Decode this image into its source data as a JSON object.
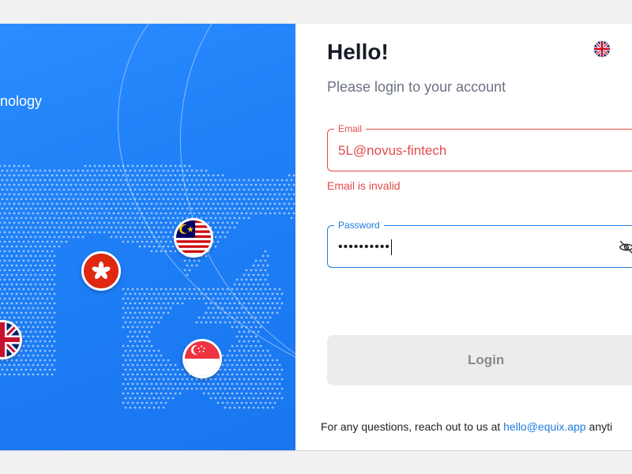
{
  "hero": {
    "tagline": "nology"
  },
  "flags": {
    "malaysia": "malaysia-flag-icon",
    "hong_kong": "hong-kong-flag-icon",
    "uk": "uk-flag-icon",
    "singapore": "singapore-flag-icon"
  },
  "login": {
    "title": "Hello!",
    "subtitle": "Please login to your account",
    "language_icon": "uk-flag-icon",
    "email": {
      "label": "Email",
      "value": "5L@novus-fintech",
      "error": "Email is invalid"
    },
    "password": {
      "label": "Password",
      "value": "••••••••••",
      "toggle_icon": "eye-off-icon"
    },
    "button_label": "Login"
  },
  "footer": {
    "text_before": "For any questions, reach out to us at ",
    "email": "hello@equix.app",
    "text_after": " anyti"
  },
  "colors": {
    "brand_blue": "#1f7ae0",
    "error_red": "#e34b4b",
    "hero_blue": "#1e7ff6",
    "button_disabled": "#ececec"
  }
}
